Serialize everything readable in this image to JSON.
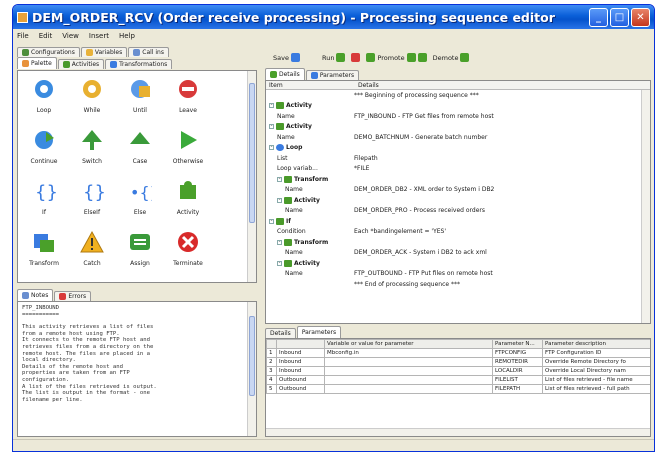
{
  "window": {
    "title": "DEM_ORDER_RCV (Order receive processing) - Processing sequence editor"
  },
  "menu": [
    "File",
    "Edit",
    "View",
    "Insert",
    "Help"
  ],
  "left_tabs_top": [
    "Configurations",
    "Variables",
    "Call ins"
  ],
  "left_tabs": [
    "Palette",
    "Activities",
    "Transformations"
  ],
  "palette": [
    {
      "label": "Loop",
      "icon": "loop-icon"
    },
    {
      "label": "While",
      "icon": "while-icon"
    },
    {
      "label": "Until",
      "icon": "until-icon"
    },
    {
      "label": "Leave",
      "icon": "leave-icon"
    },
    {
      "label": "Continue",
      "icon": "continue-icon"
    },
    {
      "label": "Switch",
      "icon": "switch-icon"
    },
    {
      "label": "Case",
      "icon": "case-icon"
    },
    {
      "label": "Otherwise",
      "icon": "otherwise-icon"
    },
    {
      "label": "If",
      "icon": "if-icon"
    },
    {
      "label": "ElseIf",
      "icon": "elseif-icon"
    },
    {
      "label": "Else",
      "icon": "else-icon"
    },
    {
      "label": "Activity",
      "icon": "activity-icon"
    },
    {
      "label": "Transform",
      "icon": "transform-icon"
    },
    {
      "label": "Catch",
      "icon": "catch-icon"
    },
    {
      "label": "Assign",
      "icon": "assign-icon"
    },
    {
      "label": "Terminate",
      "icon": "terminate-icon"
    }
  ],
  "bottom_tabs": [
    "Notes",
    "Errors"
  ],
  "notes": {
    "heading": "FTP_INBOUND",
    "underline": "===========",
    "body": "This activity retrieves a list of files\nfrom a remote host using FTP.\nIt connects to the remote FTP host and\nretrieves files from a directory on the\nremote host. The files are placed in a\nlocal directory.\nDetails of the remote host and\nproperties are taken from an FTP\nconfiguration.\nA list of the files retrieved is output.\nThe list is output in the format - one\nfilename per line."
  },
  "toolbar": {
    "save": "Save",
    "run": "Run",
    "promote": "Promote",
    "demote": "Demote"
  },
  "editor_tabs": [
    "Details",
    "Parameters"
  ],
  "tree": {
    "headers": [
      "Item",
      "Details"
    ],
    "rows": [
      {
        "depth": 0,
        "toggle": "",
        "icon": "",
        "item": "",
        "details": "*** Beginning of processing sequence ***"
      },
      {
        "depth": 0,
        "toggle": "-",
        "icon": "activity",
        "item": "Activity",
        "bold": true,
        "details": ""
      },
      {
        "depth": 1,
        "toggle": "",
        "icon": "",
        "item": "Name",
        "details": "FTP_INBOUND - FTP Get files from remote host"
      },
      {
        "depth": 0,
        "toggle": "-",
        "icon": "activity",
        "item": "Activity",
        "bold": true,
        "details": ""
      },
      {
        "depth": 1,
        "toggle": "",
        "icon": "",
        "item": "Name",
        "details": "DEMO_BATCHNUM - Generate batch number"
      },
      {
        "depth": 0,
        "toggle": "-",
        "icon": "loop",
        "item": "Loop",
        "bold": true,
        "details": ""
      },
      {
        "depth": 1,
        "toggle": "",
        "icon": "",
        "item": "List",
        "details": "Filepath"
      },
      {
        "depth": 1,
        "toggle": "",
        "icon": "",
        "item": "Loop variab...",
        "details": "*FILE"
      },
      {
        "depth": 1,
        "toggle": "-",
        "icon": "activity",
        "item": "Transform",
        "bold": true,
        "details": ""
      },
      {
        "depth": 2,
        "toggle": "",
        "icon": "",
        "item": "Name",
        "details": "DEM_ORDER_DB2 - XML order to System i DB2"
      },
      {
        "depth": 1,
        "toggle": "-",
        "icon": "activity",
        "item": "Activity",
        "bold": true,
        "details": ""
      },
      {
        "depth": 2,
        "toggle": "",
        "icon": "",
        "item": "Name",
        "details": "DEM_ORDER_PRO - Process received orders"
      },
      {
        "depth": 0,
        "toggle": "-",
        "icon": "if",
        "item": "If",
        "bold": true,
        "details": ""
      },
      {
        "depth": 1,
        "toggle": "",
        "icon": "",
        "item": "Condition",
        "details": "Each *bandingelement = 'YES'"
      },
      {
        "depth": 1,
        "toggle": "-",
        "icon": "activity",
        "item": "Transform",
        "bold": true,
        "details": ""
      },
      {
        "depth": 2,
        "toggle": "",
        "icon": "",
        "item": "Name",
        "details": "DEM_ORDER_ACK - System i DB2 to ack xml"
      },
      {
        "depth": 1,
        "toggle": "-",
        "icon": "activity",
        "item": "Activity",
        "bold": true,
        "details": ""
      },
      {
        "depth": 2,
        "toggle": "",
        "icon": "",
        "item": "Name",
        "details": "FTP_OUTBOUND - FTP Put files on remote host"
      },
      {
        "depth": 0,
        "toggle": "",
        "icon": "",
        "item": "",
        "details": "*** End of processing sequence ***"
      }
    ]
  },
  "param_tabs": [
    "Details",
    "Parameters"
  ],
  "params": {
    "headers": [
      "",
      "",
      "Variable or value for parameter",
      "Parameter N...",
      "Parameter description"
    ],
    "rows": [
      {
        "n": "1",
        "dir": "Inbound",
        "value": "Mbconfig.in",
        "name": "FTPCONFIG",
        "desc": "FTP Configuration ID"
      },
      {
        "n": "2",
        "dir": "Inbound",
        "value": "",
        "name": "REMOTEDIR",
        "desc": "Override Remote Directory fo"
      },
      {
        "n": "3",
        "dir": "Inbound",
        "value": "",
        "name": "LOCALDIR",
        "desc": "Override Local Directory nam"
      },
      {
        "n": "4",
        "dir": "Outbound",
        "value": "",
        "name": "FILELIST",
        "desc": "List of files retrieved - file name"
      },
      {
        "n": "5",
        "dir": "Outbound",
        "value": "",
        "name": "FILEPATH",
        "desc": "List of files retrieved - full path"
      }
    ]
  }
}
